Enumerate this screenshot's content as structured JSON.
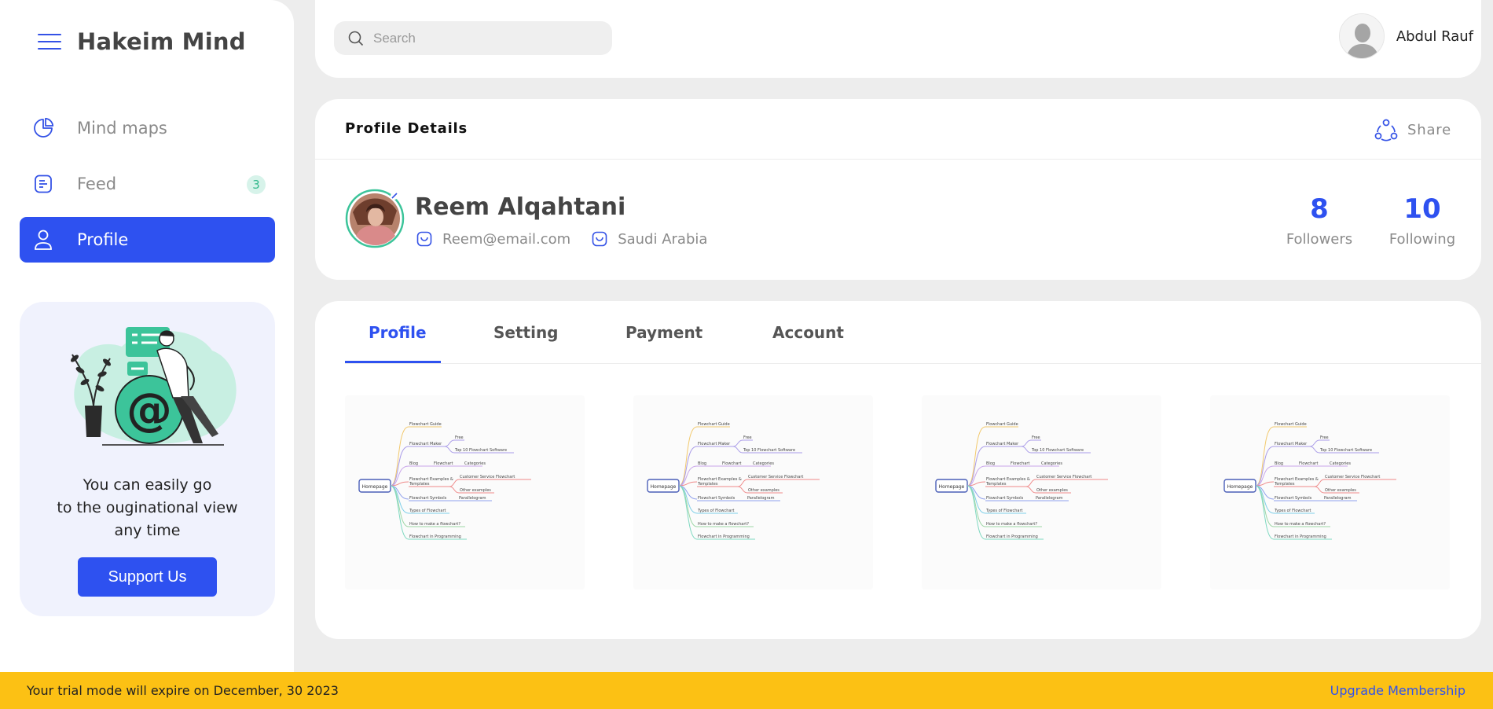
{
  "app": {
    "name": "Hakeim Mind"
  },
  "sidebar": {
    "items": [
      {
        "label": "Mind maps",
        "icon": "pie-chart-icon"
      },
      {
        "label": "Feed",
        "icon": "document-icon",
        "badge": "3"
      },
      {
        "label": "Profile",
        "icon": "user-icon",
        "active": true
      }
    ],
    "promo": {
      "line1": "You can easily go",
      "line2": "to the ouginational view",
      "line3": "any time",
      "button": "Support Us"
    }
  },
  "header": {
    "search_placeholder": "Search",
    "user_name": "Abdul Rauf"
  },
  "profile": {
    "section_title": "Profile Details",
    "share_label": "Share",
    "name": "Reem Alqahtani",
    "email": "Reem@email.com",
    "country": "Saudi Arabia",
    "followers": {
      "count": "8",
      "label": "Followers"
    },
    "following": {
      "count": "10",
      "label": "Following"
    }
  },
  "tabs": [
    {
      "label": "Profile",
      "active": true
    },
    {
      "label": "Setting"
    },
    {
      "label": "Payment"
    },
    {
      "label": "Account"
    }
  ],
  "mindmap": {
    "root": "Homepage",
    "nodes": [
      "Flowchart Guide",
      "Flowchart Maker",
      "Free",
      "Top 10 Flowchart Software",
      "Blog",
      "Flowchart",
      "Categories",
      "Flowchart Examples &",
      "Templates",
      "Customer Service Flowchart",
      "Other examples",
      "Flowchart Symbols",
      "Parallelogram",
      "Types of Flowchart",
      "How to make a flowchart?",
      "Flowchart in Programming"
    ]
  },
  "trial": {
    "message": "Your trial mode will expire on December, 30 2023",
    "upgrade": "Upgrade Membership"
  },
  "colors": {
    "accent": "#2e51f0",
    "badge_bg": "#d7f3ea",
    "badge_text": "#33b98c",
    "trial_bar": "#fcc114",
    "page_bg": "#ededed"
  }
}
